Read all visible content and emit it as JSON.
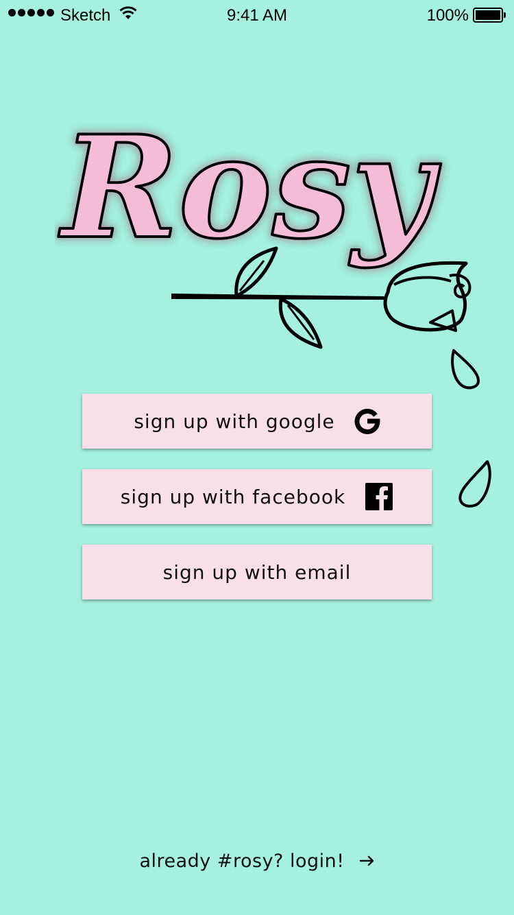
{
  "status_bar": {
    "carrier": "Sketch",
    "time": "9:41 AM",
    "battery_percent": "100%",
    "signal_icon": "signal-dots-icon",
    "wifi_icon": "wifi-icon",
    "battery_icon": "battery-icon"
  },
  "logo": {
    "text": "Rosy",
    "icon": "rose-icon",
    "fill_color": "#f5bcd7",
    "stroke_color": "#000000"
  },
  "colors": {
    "background": "#a5f0de",
    "button_background": "#f9dfea",
    "text": "#111111"
  },
  "buttons": {
    "google": {
      "label": "sign up with google",
      "icon": "google-icon"
    },
    "facebook": {
      "label": "sign up with facebook",
      "icon": "facebook-icon"
    },
    "email": {
      "label": "sign up with email"
    }
  },
  "footer": {
    "login_text": "already #rosy? login!",
    "arrow_icon": "arrow-right-icon"
  }
}
